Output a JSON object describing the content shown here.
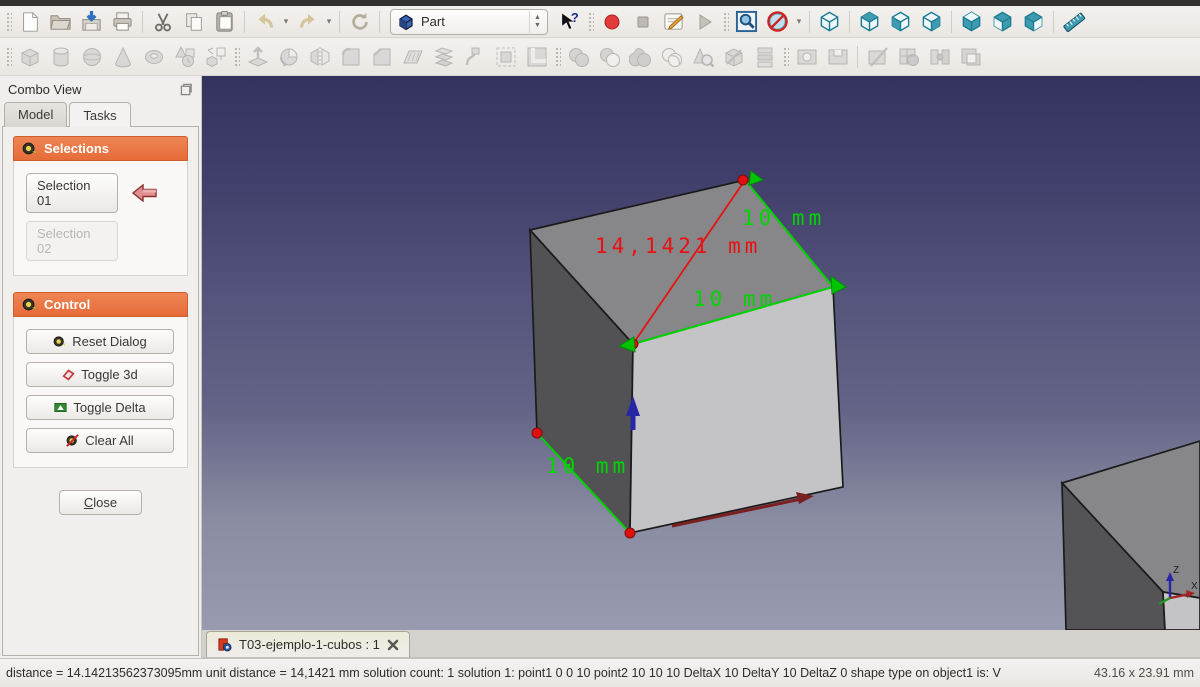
{
  "window": {
    "app": "FreeCAD"
  },
  "toolbar_main": {
    "workbench_selector": {
      "value": "Part"
    },
    "icon_names": [
      "new-file",
      "open-folder",
      "save",
      "print",
      "cut",
      "copy",
      "paste",
      "undo",
      "undo-dropdown",
      "redo",
      "redo-dropdown",
      "refresh",
      "workbench-selector",
      "whats-this",
      "macro-record",
      "macro-stop",
      "macro-edit",
      "macro-play",
      "fit-all",
      "draw-style",
      "draw-style-dropdown",
      "view-isometric",
      "view-front",
      "view-top",
      "view-right",
      "view-rear",
      "view-bottom",
      "view-left",
      "measure-linear"
    ]
  },
  "toolbar_part": {
    "icon_names": [
      "box",
      "cylinder",
      "sphere",
      "cone",
      "torus",
      "create-primitives",
      "shape-builder",
      "extrude",
      "revolve",
      "mirror",
      "fillet",
      "chamfer",
      "ruled-surface",
      "loft",
      "sweep",
      "offset",
      "thickness",
      "boolean-union",
      "boolean-common",
      "boolean-fuse",
      "boolean-cut",
      "check-geometry",
      "defeaturing",
      "compound",
      "join-connect",
      "join-cutout",
      "slice",
      "boolean-fragments",
      "slice-apart",
      "boolean-xor"
    ]
  },
  "combo_view": {
    "title": "Combo View",
    "tabs": [
      {
        "label": "Model",
        "active": false
      },
      {
        "label": "Tasks",
        "active": true
      }
    ],
    "selections": {
      "header": "Selections",
      "buttons": [
        {
          "label": "Selection 01",
          "enabled": true
        },
        {
          "label": "Selection 02",
          "enabled": false
        }
      ]
    },
    "control": {
      "header": "Control",
      "buttons": [
        "Reset Dialog",
        "Toggle 3d",
        "Toggle Delta",
        "Clear All"
      ]
    },
    "close_label": "Close"
  },
  "viewport": {
    "measurements": {
      "diagonal": "14,1421 mm",
      "edge_top_back": "10 mm",
      "edge_top_front": "10 mm",
      "edge_bottom_left": "10 mm"
    },
    "axis": {
      "z": "Z",
      "x": "X"
    },
    "colors": {
      "bg_top": "#34325e",
      "bg_bottom": "#989bb0",
      "face_top": "#87878a",
      "face_left": "#525254",
      "face_front": "#c4c4c6",
      "measure_red": "#e81111",
      "measure_green": "#00d400"
    }
  },
  "document_tabs": [
    {
      "label": "T03-ejemplo-1-cubos : 1"
    }
  ],
  "status_bar": {
    "message": "distance = 14.14213562373095mm unit distance = 14,1421 mm solution count: 1 solution 1: point1 0 0 10 point2 10 10 10 DeltaX 10 DeltaY 10 DeltaZ 0 shape type on object1 is: V",
    "dimensions": "43.16 x 23.91 mm"
  }
}
